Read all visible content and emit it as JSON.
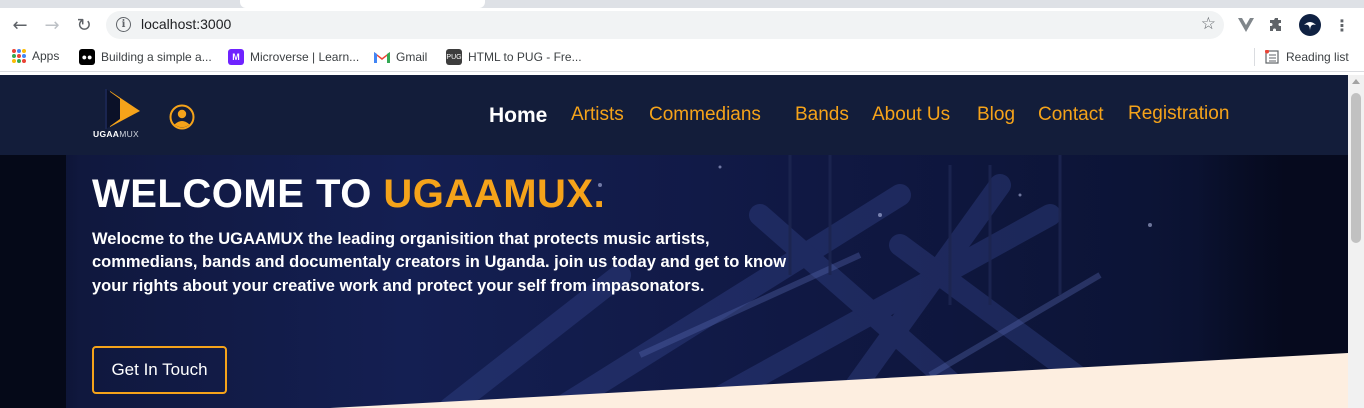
{
  "browser": {
    "url": "localhost:3000",
    "bookmarks": [
      {
        "label": "Apps"
      },
      {
        "label": "Building a simple a..."
      },
      {
        "label": "Microverse | Learn..."
      },
      {
        "label": "Gmail"
      },
      {
        "label": "HTML to PUG - Fre..."
      }
    ],
    "reading_list": "Reading list"
  },
  "site": {
    "logo_bold": "UGAA",
    "logo_light": "MUX",
    "nav": [
      {
        "label": "Home"
      },
      {
        "label": "Artists"
      },
      {
        "label": "Commedians"
      },
      {
        "label": "Bands"
      },
      {
        "label": "About Us"
      },
      {
        "label": "Blog"
      },
      {
        "label": "Contact"
      },
      {
        "label": "Registration"
      }
    ],
    "hero": {
      "title_prefix": "WELCOME TO ",
      "title_accent": "UGAAMUX.",
      "text": "Welocme to the UGAAMUX the leading organisition that protects music artists, commedians, bands and documentaly creators in Uganda. join us today and get to know your rights about your creative work and protect your self from impasonators.",
      "cta_label": "Get In Touch"
    }
  },
  "colors": {
    "header_bg": "#131d3a",
    "accent": "#f5a31a",
    "cream": "#fdeee0"
  }
}
